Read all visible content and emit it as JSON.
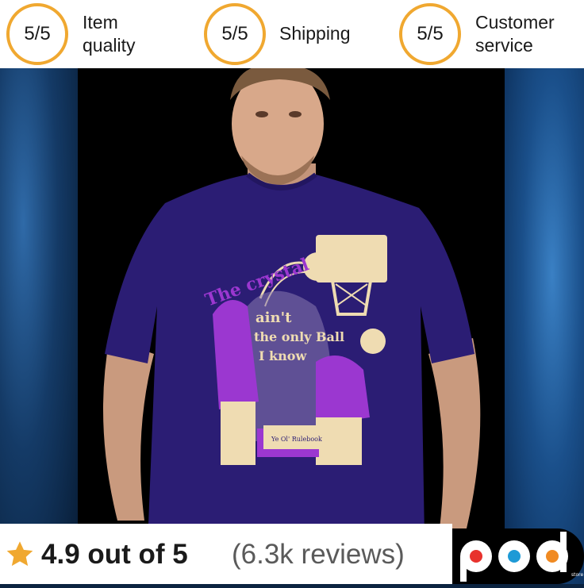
{
  "ratings": [
    {
      "score": "5/5",
      "label": "Item\nquality"
    },
    {
      "score": "5/5",
      "label": "Shipping"
    },
    {
      "score": "5/5",
      "label": "Customer\nservice"
    }
  ],
  "review": {
    "star_icon": "star-icon",
    "score_text": "4.9 out of 5",
    "count_text": "(6.3k reviews)"
  },
  "shirt": {
    "color": "#2b1d74",
    "print_text": [
      "The crystal",
      "ain't",
      "the only Ball",
      "I know"
    ],
    "book_text": "Ye Ol' Rulebook"
  },
  "logo": {
    "text": "pod",
    "subtext": "store"
  },
  "colors": {
    "accent": "#f0a830",
    "print_purple": "#9b37d0",
    "print_cream": "#efdcb2"
  }
}
